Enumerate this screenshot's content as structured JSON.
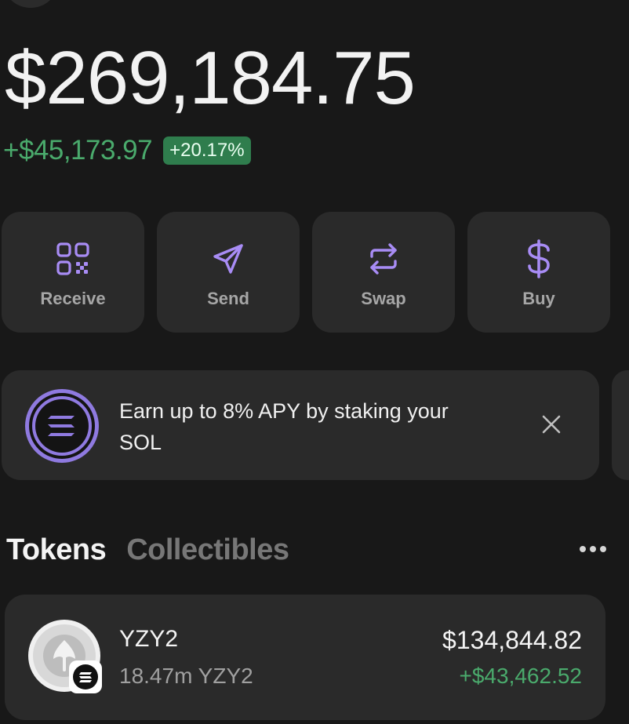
{
  "portfolio": {
    "balance": "$269,184.75",
    "change_amount": "+$45,173.97",
    "change_percent": "+20.17%"
  },
  "actions": [
    {
      "label": "Receive",
      "icon": "qr-code-icon"
    },
    {
      "label": "Send",
      "icon": "send-icon"
    },
    {
      "label": "Swap",
      "icon": "swap-icon"
    },
    {
      "label": "Buy",
      "icon": "dollar-icon"
    }
  ],
  "promo": {
    "text": "Earn up to 8% APY by staking your SOL",
    "logo_icon": "solana-icon",
    "close_icon": "close-icon"
  },
  "tabs": {
    "active": "Tokens",
    "inactive": "Collectibles",
    "more_icon": "more-horizontal-icon"
  },
  "tokens": [
    {
      "name": "YZY2",
      "amount": "18.47m YZY2",
      "value": "$134,844.82",
      "change": "+$43,462.52"
    }
  ],
  "colors": {
    "background": "#181818",
    "card": "#2a2a2a",
    "accent_purple": "#a88cf5",
    "positive_green": "#4aaa6c",
    "badge_green": "#2f7d4d",
    "muted_text": "#a6a6a6"
  }
}
